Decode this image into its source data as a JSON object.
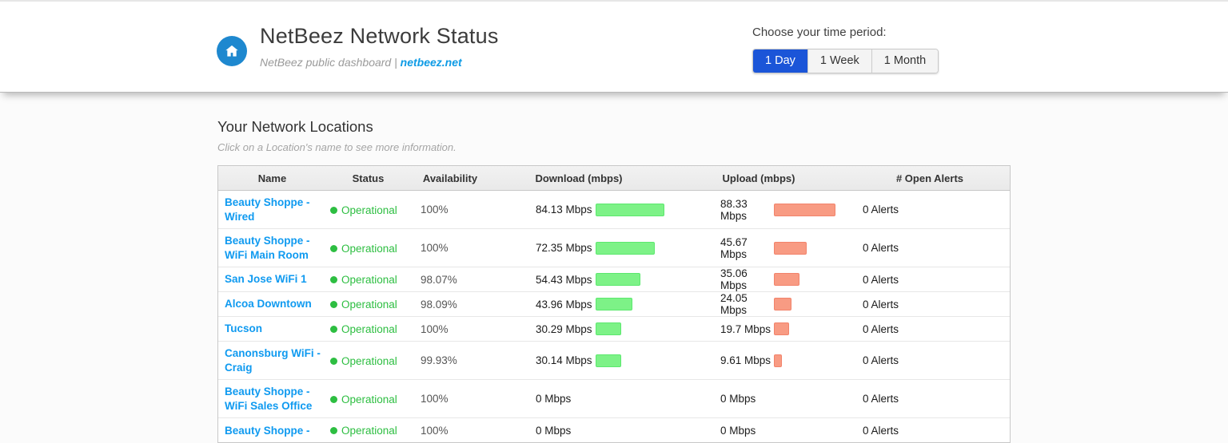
{
  "header": {
    "title": "NetBeez Network Status",
    "subtitle_prefix": "NetBeez public dashboard | ",
    "subtitle_link": "netbeez.net",
    "time_period_label": "Choose your time period:",
    "time_buttons": [
      {
        "label": "1 Day",
        "active": true
      },
      {
        "label": "1 Week",
        "active": false
      },
      {
        "label": "1 Month",
        "active": false
      }
    ]
  },
  "section": {
    "title": "Your Network Locations",
    "subtitle": "Click on a Location's name to see more information."
  },
  "table": {
    "columns": [
      "Name",
      "Status",
      "Availability",
      "Download (mbps)",
      "Upload (mbps)",
      "# Open Alerts"
    ],
    "rows": [
      {
        "name": "Beauty Shoppe - Wired",
        "status": "Operational",
        "availability": "100%",
        "download": "84.13 Mbps",
        "download_value": 84.13,
        "upload": "88.33 Mbps",
        "upload_value": 88.33,
        "alerts": "0 Alerts"
      },
      {
        "name": "Beauty Shoppe - WiFi Main Room",
        "status": "Operational",
        "availability": "100%",
        "download": "72.35 Mbps",
        "download_value": 72.35,
        "upload": "45.67 Mbps",
        "upload_value": 45.67,
        "alerts": "0 Alerts"
      },
      {
        "name": "San Jose WiFi 1",
        "status": "Operational",
        "availability": "98.07%",
        "download": "54.43 Mbps",
        "download_value": 54.43,
        "upload": "35.06 Mbps",
        "upload_value": 35.06,
        "alerts": "0 Alerts"
      },
      {
        "name": "Alcoa Downtown",
        "status": "Operational",
        "availability": "98.09%",
        "download": "43.96 Mbps",
        "download_value": 43.96,
        "upload": "24.05 Mbps",
        "upload_value": 24.05,
        "alerts": "0 Alerts"
      },
      {
        "name": "Tucson",
        "status": "Operational",
        "availability": "100%",
        "download": "30.29 Mbps",
        "download_value": 30.29,
        "upload": "19.7 Mbps",
        "upload_value": 19.7,
        "alerts": "0 Alerts"
      },
      {
        "name": "Canonsburg WiFi - Craig",
        "status": "Operational",
        "availability": "99.93%",
        "download": "30.14 Mbps",
        "download_value": 30.14,
        "upload": "9.61 Mbps",
        "upload_value": 9.61,
        "alerts": "0 Alerts"
      },
      {
        "name": "Beauty Shoppe - WiFi Sales Office",
        "status": "Operational",
        "availability": "100%",
        "download": "0 Mbps",
        "download_value": 0,
        "upload": "0 Mbps",
        "upload_value": 0,
        "alerts": "0 Alerts"
      },
      {
        "name": "Beauty Shoppe -",
        "status": "Operational",
        "availability": "100%",
        "download": "0 Mbps",
        "download_value": 0,
        "upload": "0 Mbps",
        "upload_value": 0,
        "alerts": "0 Alerts"
      }
    ]
  },
  "colors": {
    "accent_blue": "#1b55d8",
    "link_blue": "#0f9af0",
    "status_green": "#2dbe41",
    "download_bar": "#7df287",
    "upload_bar": "#f89b83",
    "home_badge": "#1e88cf"
  }
}
